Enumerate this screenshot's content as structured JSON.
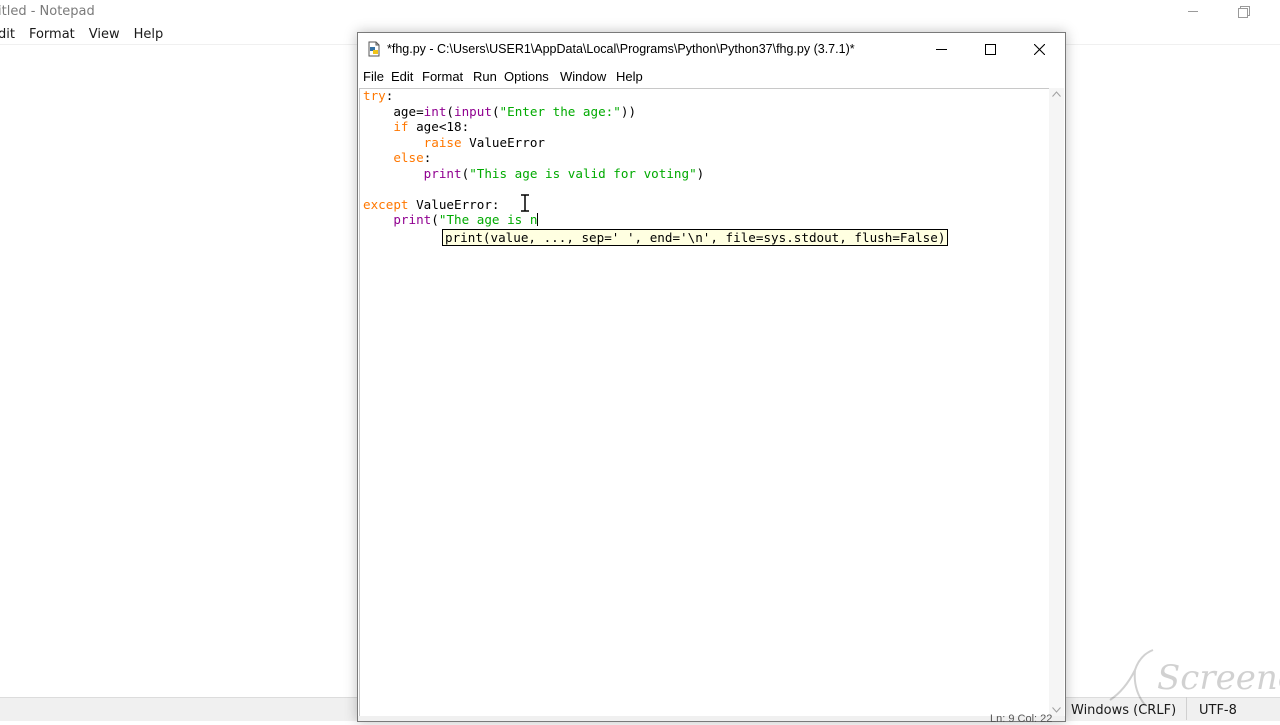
{
  "notepad": {
    "title": "itled - Notepad",
    "menu": [
      "dit",
      "Format",
      "View",
      "Help"
    ],
    "status_line_ending": "Windows (CRLF)",
    "status_encoding": "UTF-8"
  },
  "idle": {
    "title": "*fhg.py - C:\\Users\\USER1\\AppData\\Local\\Programs\\Python\\Python37\\fhg.py (3.7.1)*",
    "menu": [
      "File",
      "Edit",
      "Format",
      "Run",
      "Options",
      "Window",
      "Help"
    ],
    "code": {
      "l1_kw": "try",
      "l1_rest": ":",
      "l2_a": "    age=",
      "l2_int": "int",
      "l2_b": "(",
      "l2_input": "input",
      "l2_c": "(",
      "l2_str": "\"Enter the age:\"",
      "l2_d": "))",
      "l3_indent": "    ",
      "l3_kw": "if",
      "l3_rest": " age<18:",
      "l4_indent": "        ",
      "l4_kw": "raise",
      "l4_rest": " ValueError",
      "l5_indent": "    ",
      "l5_kw": "else",
      "l5_rest": ":",
      "l6_indent": "        ",
      "l6_fn": "print",
      "l6_b": "(",
      "l6_str": "\"This age is valid for voting\"",
      "l6_c": ")",
      "l8_kw": "except",
      "l8_rest": " ValueError:",
      "l9_indent": "    ",
      "l9_fn": "print",
      "l9_b": "(",
      "l9_str": "\"The age is n"
    },
    "calltip": "print(value, ..., sep=' ', end='\\n', file=sys.stdout, flush=False)",
    "status": "Ln: 9  Col: 22"
  },
  "watermark": "Screencast-O-Matic",
  "colors": {
    "keyword": "#ff7700",
    "builtin": "#900090",
    "string": "#00aa00",
    "calltip_bg": "#ffffe1"
  }
}
